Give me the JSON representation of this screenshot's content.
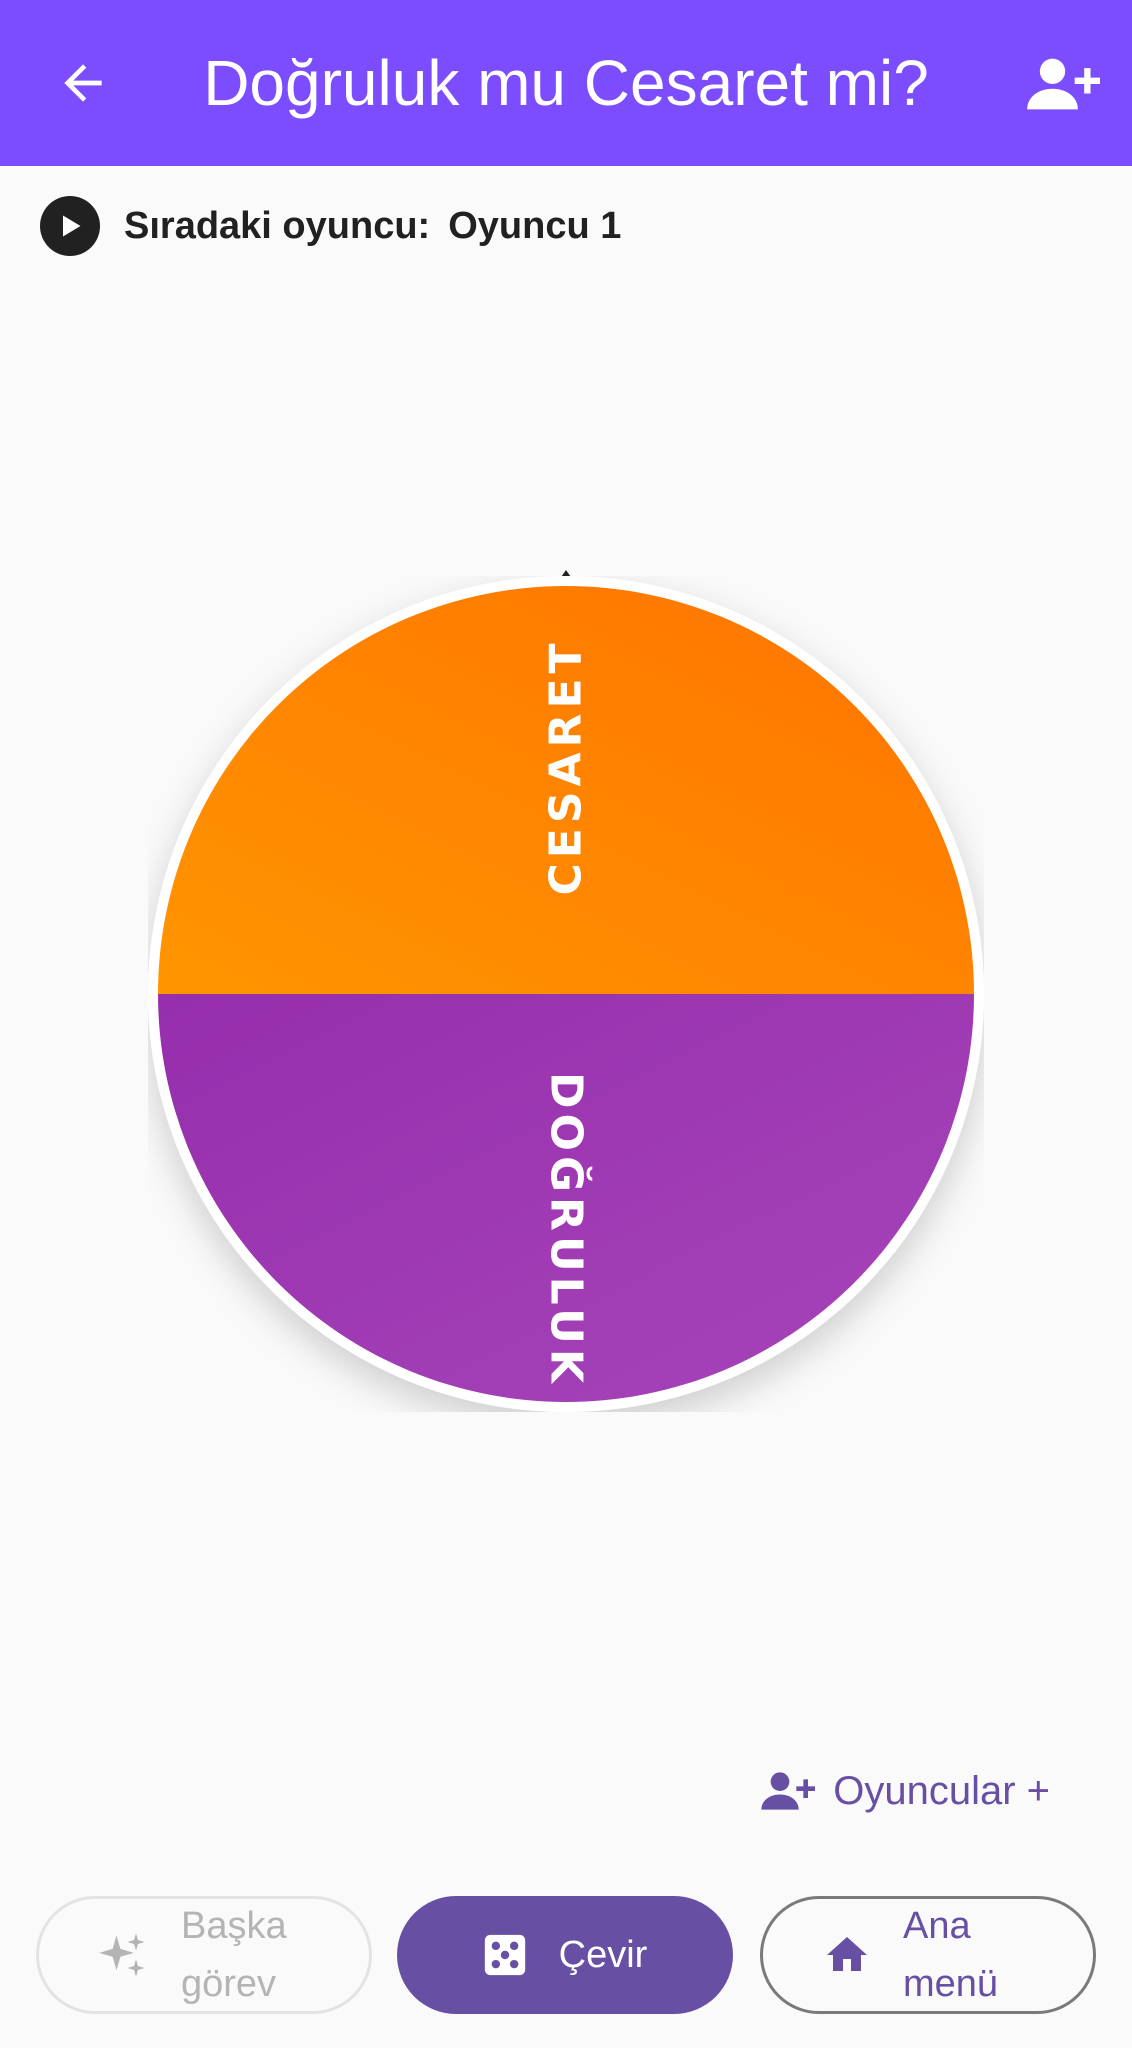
{
  "app_bar": {
    "title": "Doğruluk mu Cesaret mi?",
    "back_icon": "arrow-back-icon",
    "add_player_icon": "person-add-icon",
    "background": "#7c4dff"
  },
  "status": {
    "label": "Sıradaki oyuncu:",
    "player": "Oyuncu 1",
    "icon": "play-circle-icon"
  },
  "wheel": {
    "segments": [
      {
        "label": "CESARET",
        "color": "#ff8800"
      },
      {
        "label": "DOĞRULUK",
        "color": "#9c3cb4"
      }
    ],
    "pointer_icon": "pointer-triangle-icon"
  },
  "players_link": {
    "label": "Oyuncular +",
    "icon": "person-add-icon"
  },
  "buttons": {
    "other_task": "Başka görev",
    "spin": "Çevir",
    "main_menu": "Ana menü"
  },
  "colors": {
    "accent": "#6750a4",
    "orange": "#ff8800",
    "purple": "#9c3cb4"
  }
}
